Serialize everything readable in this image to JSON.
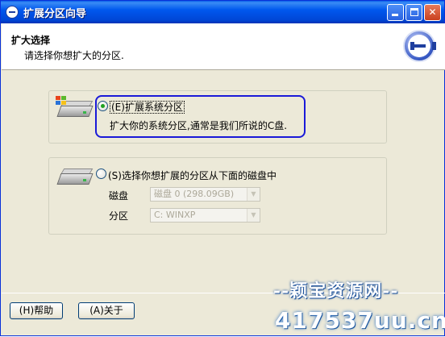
{
  "window": {
    "title": "扩展分区向导"
  },
  "header": {
    "title": "扩大选择",
    "subtitle": "请选择你想扩大的分区."
  },
  "options": [
    {
      "label": "(E)扩展系统分区",
      "description": "扩大你的系统分区,通常是我们所说的C盘.",
      "checked": true
    },
    {
      "label": "(S)选择你想扩展的分区从下面的磁盘中",
      "checked": false
    }
  ],
  "fields": {
    "disk_label": "磁盘",
    "disk_value": "磁盘 0 (298.09GB)",
    "partition_label": "分区",
    "partition_value": "C: WINXP"
  },
  "buttons": {
    "help": "(H)帮助",
    "about": "(A)关于"
  },
  "watermark": {
    "line1": "--颖宝资源网--",
    "line2": "417537uu.cn"
  },
  "colors": {
    "titlebar": "#0058ee",
    "highlight_border": "#1a1ad8",
    "window_bg": "#ece9d8"
  }
}
